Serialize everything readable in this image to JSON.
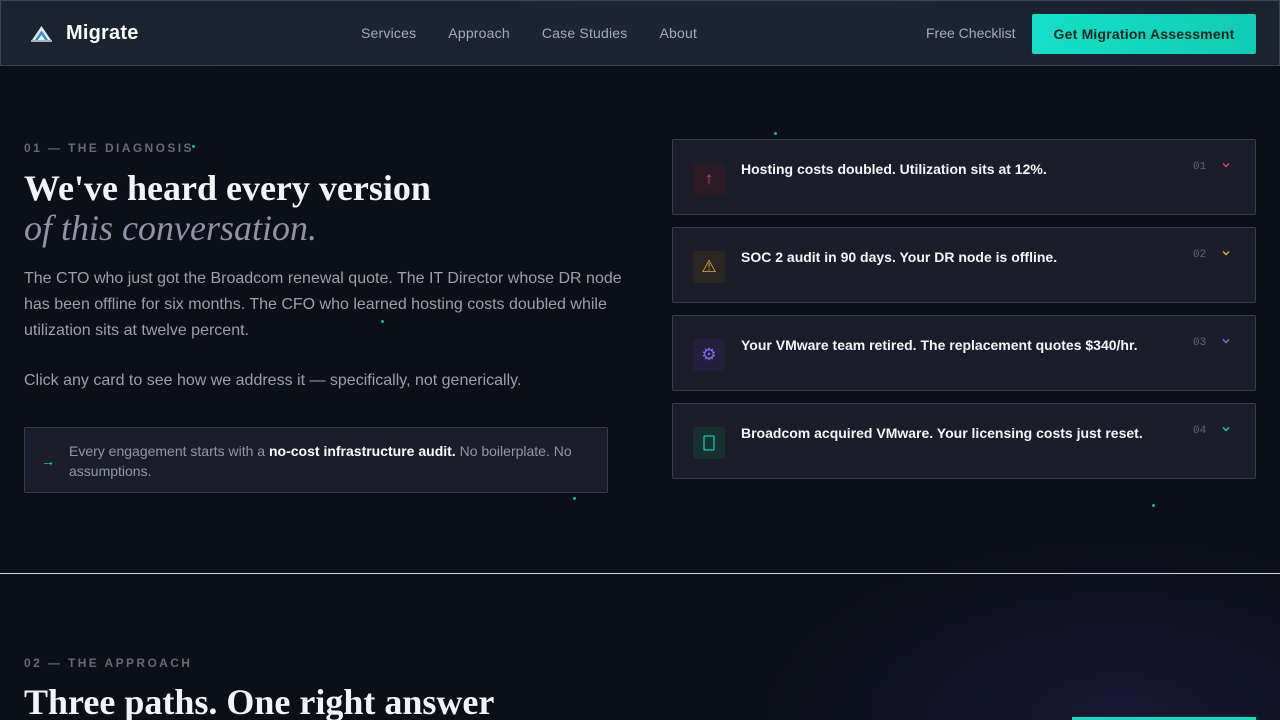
{
  "nav": {
    "brand": "Migrate",
    "links": [
      "Services",
      "Approach",
      "Case Studies",
      "About"
    ],
    "free_checklist": "Free Checklist",
    "cta": "Get Migration Assessment"
  },
  "diagnosis": {
    "eyebrow": "01 — THE DIAGNOSIS",
    "heading_line1": "We've heard every version",
    "heading_line2": "of this conversation.",
    "paragraph1": "The CTO who just got the Broadcom renewal quote. The IT Director whose DR node has been offline for six months. The CFO who learned hosting costs doubled while utilization sits at twelve percent.",
    "paragraph2": "Click any card to see how we address it — specifically, not generically.",
    "audit_prefix": "Every engagement starts with a ",
    "audit_bold": "no-cost infrastructure audit.",
    "audit_suffix": " No boilerplate. No assumptions."
  },
  "cards": [
    {
      "title": "Hosting costs doubled. Utilization sits at 12%.",
      "number": "01",
      "icon": "arrow-up-icon",
      "glyph": "↑",
      "accent": "#e0445e"
    },
    {
      "title": "SOC 2 audit in 90 days. Your DR node is offline.",
      "number": "02",
      "icon": "warning-icon",
      "glyph": "⚠",
      "accent": "#e8a93a"
    },
    {
      "title": "Your VMware team retired. The replacement quotes $340/hr.",
      "number": "03",
      "icon": "gear-icon",
      "glyph": "⚙",
      "accent": "#7f6df0"
    },
    {
      "title": "Broadcom acquired VMware. Your licensing costs just reset.",
      "number": "04",
      "icon": "document-icon",
      "glyph": "▯",
      "accent": "#14c6b3"
    }
  ],
  "approach": {
    "eyebrow": "02 — THE APPROACH",
    "heading": "Three paths. One right answer"
  },
  "colors": {
    "accent": "#14d9c2",
    "background": "#0b0f17",
    "card": "#1b1e2a"
  }
}
